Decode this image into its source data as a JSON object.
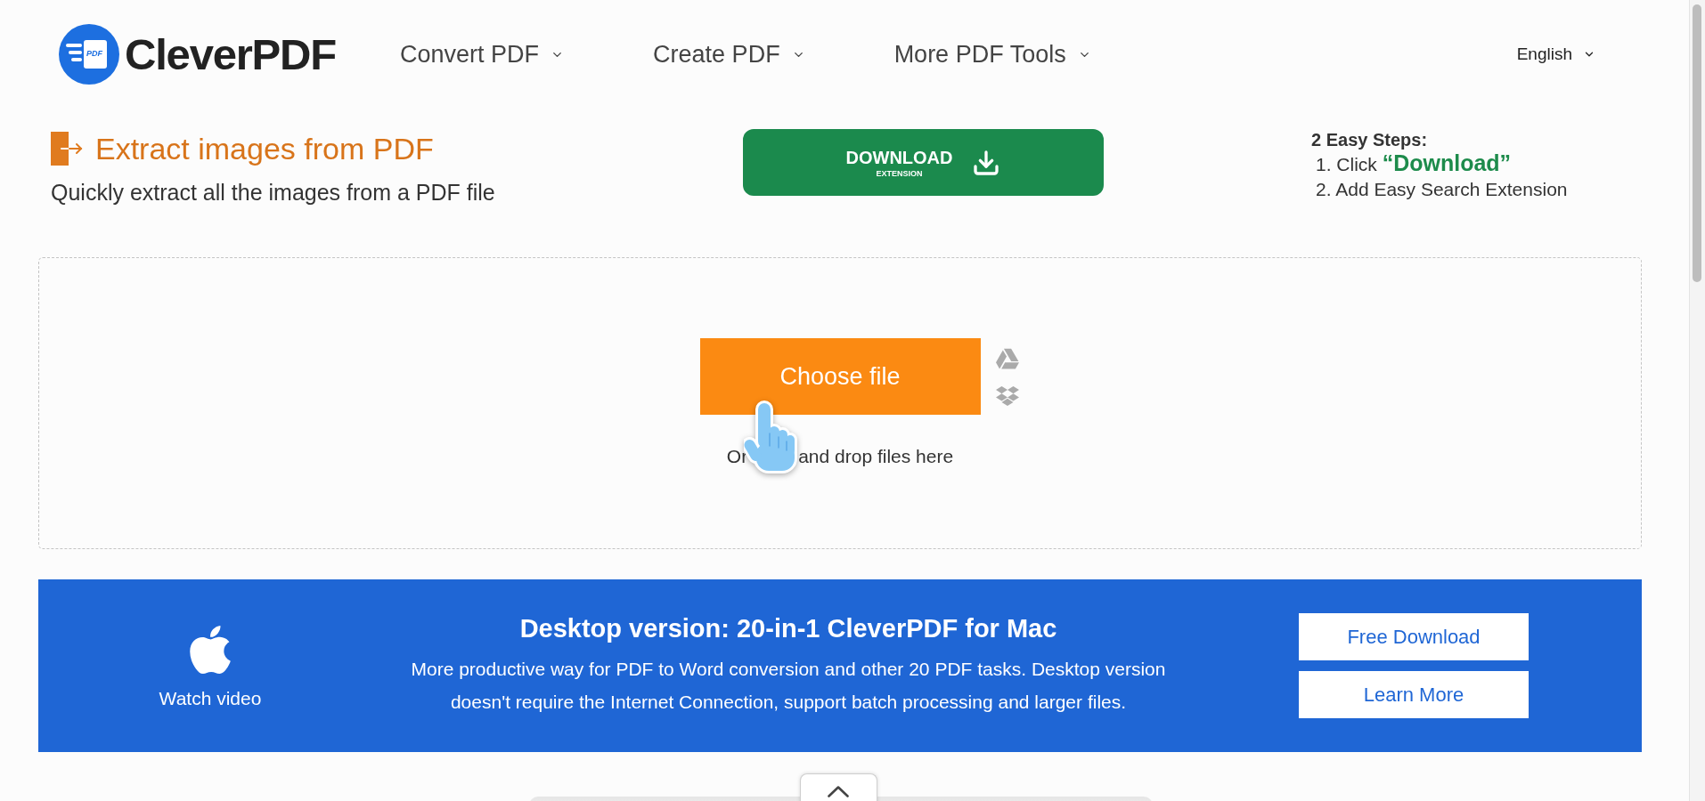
{
  "header": {
    "logo": {
      "mark_text": "PDF",
      "name": "CleverPDF"
    },
    "nav": [
      {
        "label": "Convert PDF"
      },
      {
        "label": "Create PDF"
      },
      {
        "label": "More PDF Tools"
      }
    ],
    "language": "English"
  },
  "tool": {
    "title": "Extract images from PDF",
    "subtitle": "Quickly extract all the images from a PDF file"
  },
  "extension_button": {
    "label": "DOWNLOAD",
    "sublabel": "EXTENSION"
  },
  "steps": {
    "title": "2 Easy Steps:",
    "items": [
      "1. Click **“Download”**",
      "2. Add Easy Search Extension"
    ]
  },
  "upload": {
    "button": "Choose file",
    "sources": [
      {
        "kind": "drive"
      },
      {
        "kind": "dropbox"
      }
    ],
    "drop_hint": [
      "Or",
      "and drop files here"
    ]
  },
  "promo": {
    "link": "Watch video",
    "title": "Desktop version: 20-in-1 CleverPDF for Mac",
    "text": "More productive way for PDF to Word conversion and other 20 PDF tasks. Desktop version doesn't require the Internet Connection, support batch processing and larger files.",
    "buttons": [
      "Free Download",
      "Learn More"
    ]
  }
}
